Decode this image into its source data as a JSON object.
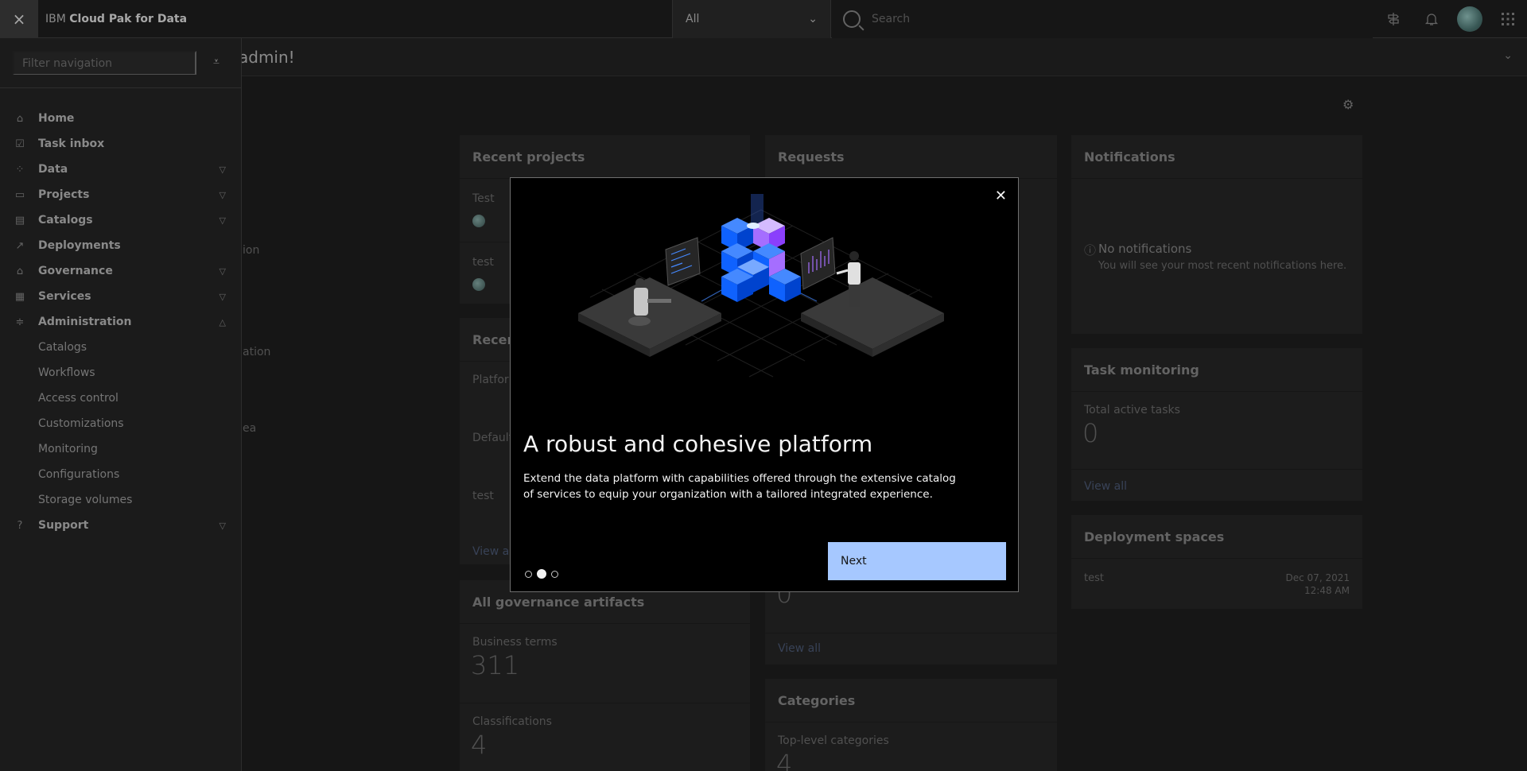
{
  "header": {
    "close_label": "×",
    "brand_prefix": "IBM",
    "brand_name": "Cloud Pak for Data",
    "scope_value": "All",
    "search_placeholder": "Search"
  },
  "welcome": {
    "text": "admin!"
  },
  "sidenav": {
    "filter_placeholder": "Filter navigation",
    "items": [
      {
        "label": "Home",
        "icon": "home-icon"
      },
      {
        "label": "Task inbox",
        "icon": "task-icon"
      },
      {
        "label": "Data",
        "icon": "data-icon",
        "expandable": true
      },
      {
        "label": "Projects",
        "icon": "folder-icon",
        "expandable": true
      },
      {
        "label": "Catalogs",
        "icon": "catalog-icon",
        "expandable": true
      },
      {
        "label": "Deployments",
        "icon": "chart-icon"
      },
      {
        "label": "Governance",
        "icon": "governance-icon",
        "expandable": true
      },
      {
        "label": "Services",
        "icon": "grid-icon",
        "expandable": true
      },
      {
        "label": "Administration",
        "icon": "settings-adjust-icon",
        "expandable": true,
        "expanded": true
      }
    ],
    "admin_sub": [
      "Catalogs",
      "Workflows",
      "Access control",
      "Customizations",
      "Monitoring",
      "Configurations",
      "Storage volumes"
    ],
    "support": {
      "label": "Support",
      "icon": "help-icon"
    }
  },
  "peek": [
    "ion",
    "ation",
    "ea"
  ],
  "cards": {
    "recent_projects": {
      "title": "Recent projects",
      "p1": "Test",
      "p2": "test"
    },
    "recent": {
      "title": "Recen",
      "r1": "Platfor",
      "r2": "Default",
      "r3": "test",
      "view_all": "View al"
    },
    "requests": {
      "title": "Requests",
      "num": "0",
      "view_all": "View all"
    },
    "notifications": {
      "title": "Notifications",
      "empty_title": "No notifications",
      "empty_sub": "You will see your most recent notifications here."
    },
    "task_monitoring": {
      "title": "Task monitoring",
      "label": "Total active tasks",
      "value": "0",
      "view_all": "View all"
    },
    "deployment_spaces": {
      "title": "Deployment spaces",
      "name": "test",
      "date": "Dec 07, 2021",
      "time": "12:48 AM"
    },
    "governance": {
      "title": "All governance artifacts",
      "bt_label": "Business terms",
      "bt_value": "311",
      "cl_label": "Classifications",
      "cl_value": "4"
    },
    "categories": {
      "title": "Categories",
      "label": "Top-level categories",
      "value": "4"
    }
  },
  "modal": {
    "title": "A robust and cohesive platform",
    "body": "Extend the data platform with capabilities offered through the extensive catalog of services to equip your organization with a tailored integrated experience.",
    "next_label": "Next",
    "steps": 3,
    "active_step": 2
  },
  "colors": {
    "accent": "#a6c8ff",
    "background": "#161616",
    "cube_blue": "#0f62fe",
    "cube_purple": "#a56eff"
  }
}
